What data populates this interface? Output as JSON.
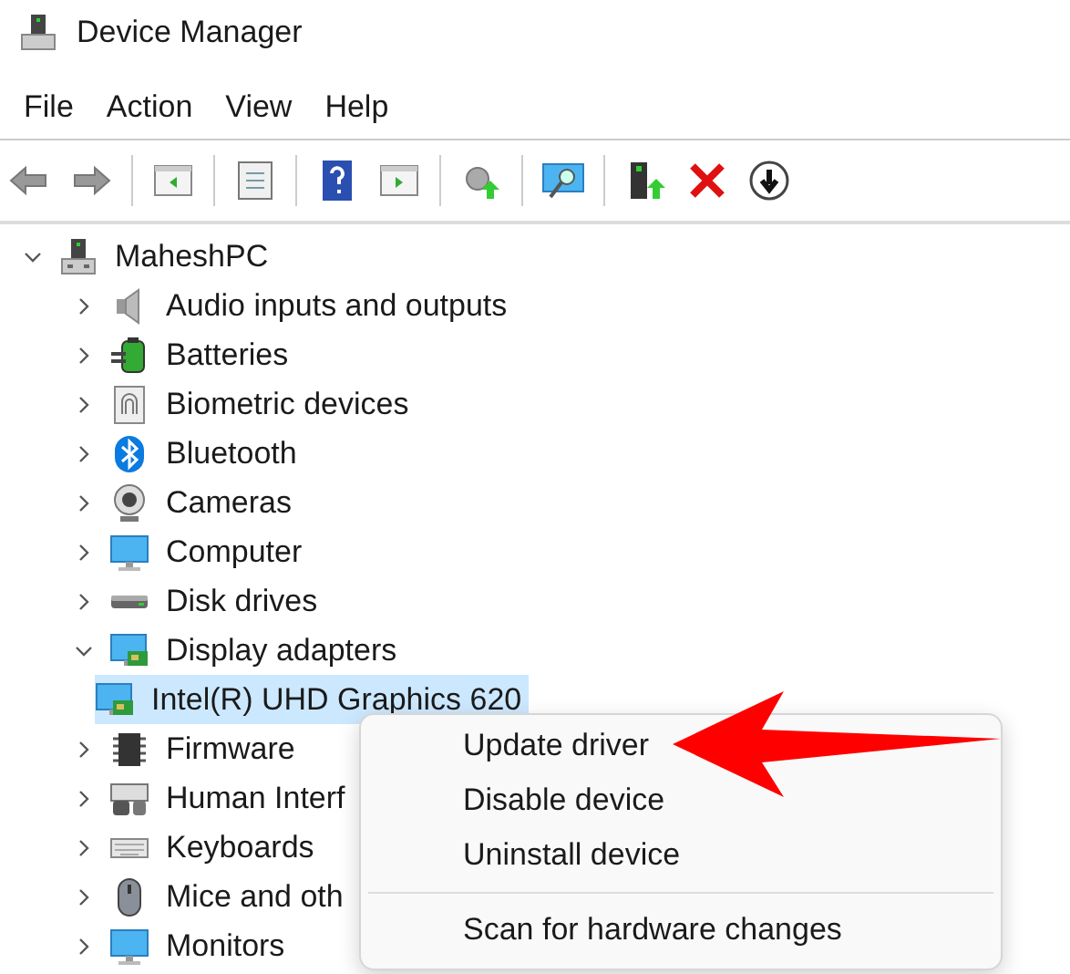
{
  "window": {
    "title": "Device Manager"
  },
  "menu_bar": [
    "File",
    "Action",
    "View",
    "Help"
  ],
  "tree": {
    "label": "MaheshPC",
    "expanded": true,
    "selected": false,
    "children": [
      {
        "label": "Audio inputs and outputs",
        "expanded": false,
        "selected": false
      },
      {
        "label": "Batteries",
        "expanded": false,
        "selected": false
      },
      {
        "label": "Biometric devices",
        "expanded": false,
        "selected": false
      },
      {
        "label": "Bluetooth",
        "expanded": false,
        "selected": false
      },
      {
        "label": "Cameras",
        "expanded": false,
        "selected": false
      },
      {
        "label": "Computer",
        "expanded": false,
        "selected": false
      },
      {
        "label": "Disk drives",
        "expanded": false,
        "selected": false
      },
      {
        "label": "Display adapters",
        "expanded": true,
        "selected": false,
        "children": [
          {
            "label": "Intel(R) UHD Graphics 620",
            "selected": true
          }
        ]
      },
      {
        "label": "Firmware",
        "expanded": false,
        "selected": false
      },
      {
        "label": "Human Interf",
        "expanded": false,
        "selected": false
      },
      {
        "label": "Keyboards",
        "expanded": false,
        "selected": false
      },
      {
        "label": "Mice and oth",
        "expanded": false,
        "selected": false
      },
      {
        "label": "Monitors",
        "expanded": false,
        "selected": false
      }
    ]
  },
  "context_menu": {
    "items": [
      {
        "kind": "item",
        "label": "Update driver"
      },
      {
        "kind": "item",
        "label": "Disable device"
      },
      {
        "kind": "item",
        "label": "Uninstall device"
      },
      {
        "kind": "separator"
      },
      {
        "kind": "item",
        "label": "Scan for hardware changes"
      }
    ]
  }
}
